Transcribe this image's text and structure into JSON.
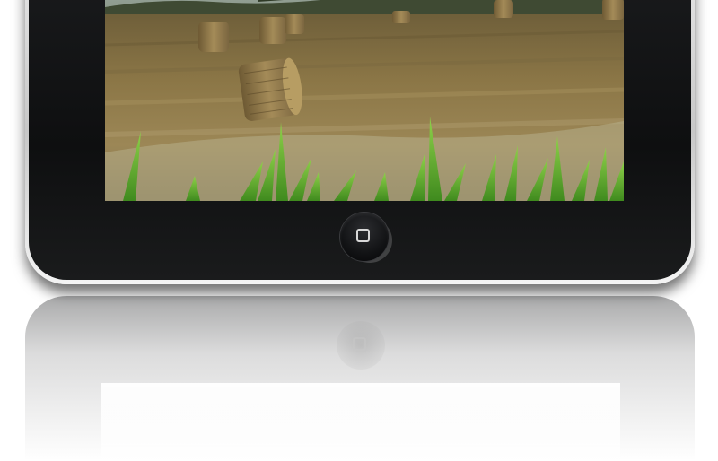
{
  "device": {
    "body_color": "#0e0f10",
    "frame_color": "#d0d0d0",
    "home_button_icon": "home-square-icon"
  },
  "screen": {
    "content": "photo"
  }
}
